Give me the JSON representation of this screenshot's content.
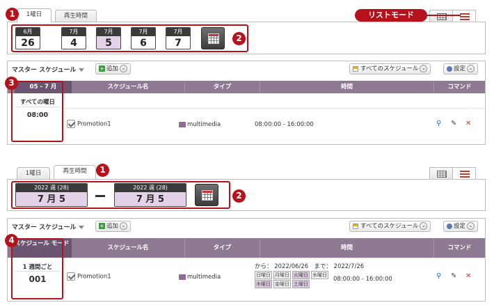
{
  "top": {
    "tabs": [
      {
        "label": "1曜日"
      },
      {
        "label": "再生時間"
      }
    ],
    "list_mode_label": "リストモード",
    "dates": [
      {
        "month": "6月",
        "day": "26"
      },
      {
        "month": "7月",
        "day": "4"
      },
      {
        "month": "7月",
        "day": "5"
      },
      {
        "month": "7月",
        "day": "6"
      },
      {
        "month": "7月",
        "day": "7"
      }
    ],
    "toolbar": {
      "master": "マスター スケジュール",
      "add": "追加",
      "all_schedules": "すべてのスケジュール",
      "settings": "設定"
    },
    "columns": [
      "05 - 7 月",
      "スケジュール名",
      "タイプ",
      "時間",
      "コマンド"
    ],
    "left_panel": {
      "label": "すべての曜日",
      "time": "08:00"
    },
    "row": {
      "name": "Promotion1",
      "type": "multimedia",
      "time": "08:00:00 - 16:00:00"
    }
  },
  "bottom": {
    "tabs": [
      {
        "label": "1曜日"
      },
      {
        "label": "再生時間"
      }
    ],
    "range_start": {
      "week": "2022 週 (28)",
      "date": "7 月 5"
    },
    "range_end": {
      "week": "2022 週 (28)",
      "date": "7 月 5"
    },
    "toolbar": {
      "master": "マスター スケジュール",
      "add": "追加",
      "all_schedules": "すべてのスケジュール",
      "settings": "設定"
    },
    "columns": [
      "スケジュール モード",
      "スケジュール名",
      "タイプ",
      "時間",
      "コマンド"
    ],
    "left_panel": {
      "label": "1 週間ごと",
      "value": "001"
    },
    "row": {
      "name": "Promotion1",
      "type": "multimedia",
      "from_label": "から：",
      "from": "2022/06/26",
      "to_label": "まで：",
      "to": "2022/7/26",
      "days": [
        {
          "label": "日曜日",
          "on": false
        },
        {
          "label": "月曜日",
          "on": false
        },
        {
          "label": "火曜日",
          "on": true
        },
        {
          "label": "水曜日",
          "on": false
        },
        {
          "label": "木曜日",
          "on": true
        },
        {
          "label": "金曜日",
          "on": false
        },
        {
          "label": "土曜日",
          "on": true
        }
      ],
      "time": "08:00:00 - 16:00:00"
    }
  },
  "badges": [
    "1",
    "2",
    "3",
    "1",
    "2",
    "4"
  ],
  "colors": {
    "accent_red": "#b5121b",
    "header_purple": "#8e7a92",
    "selected_lilac": "#e3d2e8"
  }
}
